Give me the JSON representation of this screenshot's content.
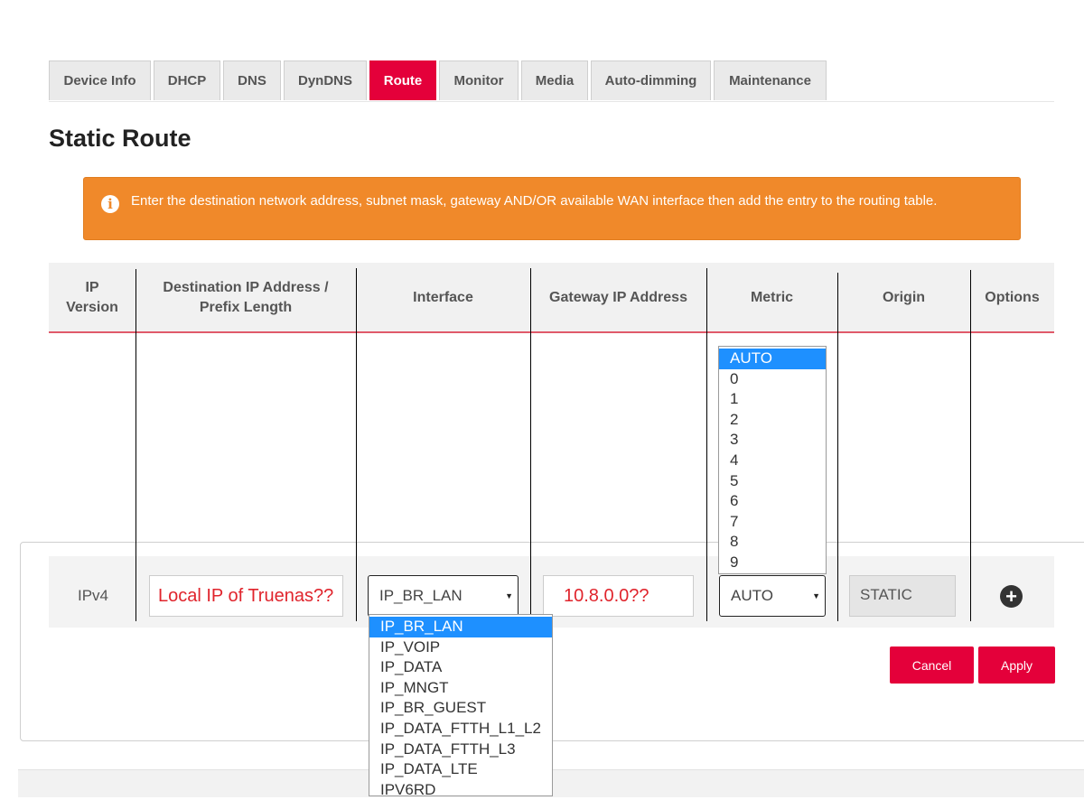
{
  "tabs": [
    {
      "label": "Device Info",
      "active": false
    },
    {
      "label": "DHCP",
      "active": false
    },
    {
      "label": "DNS",
      "active": false
    },
    {
      "label": "DynDNS",
      "active": false
    },
    {
      "label": "Route",
      "active": true
    },
    {
      "label": "Monitor",
      "active": false
    },
    {
      "label": "Media",
      "active": false
    },
    {
      "label": "Auto-dimming",
      "active": false
    },
    {
      "label": "Maintenance",
      "active": false
    }
  ],
  "page": {
    "title": "Static Route"
  },
  "alert": {
    "icon": "info-icon",
    "text": "Enter the destination network address, subnet mask, gateway AND/OR available WAN interface then add the entry to the routing table."
  },
  "table": {
    "headers": {
      "ip_version": "IP Version",
      "destination": "Destination IP Address / Prefix Length",
      "interface": "Interface",
      "gateway": "Gateway IP Address",
      "metric": "Metric",
      "origin": "Origin",
      "options": "Options"
    },
    "row": {
      "ip_version": "IPv4",
      "destination_value": "Local IP of Truenas??",
      "interface_value": "IP_BR_LAN",
      "gateway_value": "10.8.0.0??",
      "metric_value": "AUTO",
      "origin_value": "STATIC",
      "add_icon": "plus-circle-icon"
    }
  },
  "metric_options": [
    "AUTO",
    "0",
    "1",
    "2",
    "3",
    "4",
    "5",
    "6",
    "7",
    "8",
    "9"
  ],
  "interface_options": [
    "IP_BR_LAN",
    "IP_VOIP",
    "IP_DATA",
    "IP_MNGT",
    "IP_BR_GUEST",
    "IP_DATA_FTTH_L1_L2",
    "IP_DATA_FTTH_L3",
    "IP_DATA_LTE",
    "IPV6RD"
  ],
  "buttons": {
    "cancel": "Cancel",
    "apply": "Apply"
  },
  "colors": {
    "accent": "#e4003a",
    "alert": "#f0892a",
    "annotation": "#e0242c",
    "selection": "#1e90ff"
  }
}
